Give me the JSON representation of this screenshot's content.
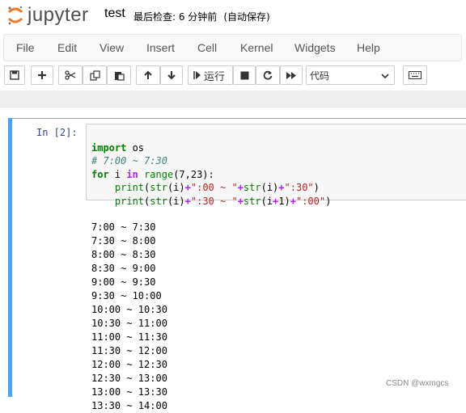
{
  "header": {
    "app_name": "jupyter",
    "notebook_title": "test",
    "checkpoint_text": "最后检查: 6 分钟前",
    "save_state": "(自动保存)"
  },
  "menu": {
    "items": [
      "File",
      "Edit",
      "View",
      "Insert",
      "Cell",
      "Kernel",
      "Widgets",
      "Help"
    ]
  },
  "toolbar": {
    "run_label": "运行",
    "cell_type": "代码",
    "icons": [
      "save-icon",
      "plus-icon",
      "cut-icon",
      "copy-icon",
      "paste-icon",
      "arrow-up-icon",
      "arrow-down-icon",
      "run-icon",
      "stop-icon",
      "restart-icon",
      "fast-forward-icon",
      "keyboard-icon"
    ]
  },
  "cell": {
    "prompt": "In  [2]:",
    "code_lines": [
      "import os",
      "# 7:00 ~ 7:30",
      "for i in range(7,23):",
      "    print(str(i)+\":00 ~ \"+str(i)+\":30\")",
      "    print(str(i)+\":30 ~ \"+str(i+1)+\":00\")"
    ],
    "output_lines": [
      "7:00 ~ 7:30",
      "7:30 ~ 8:00",
      "8:00 ~ 8:30",
      "8:30 ~ 9:00",
      "9:00 ~ 9:30",
      "9:30 ~ 10:00",
      "10:00 ~ 10:30",
      "10:30 ~ 11:00",
      "11:00 ~ 11:30",
      "11:30 ~ 12:00",
      "12:00 ~ 12:30",
      "12:30 ~ 13:00",
      "13:00 ~ 13:30",
      "13:30 ~ 14:00"
    ]
  },
  "watermark": "CSDN @wxmgcs",
  "colors": {
    "accent": "#42a5f5",
    "logo_orange": "#f37726",
    "prompt": "#303f9f"
  }
}
